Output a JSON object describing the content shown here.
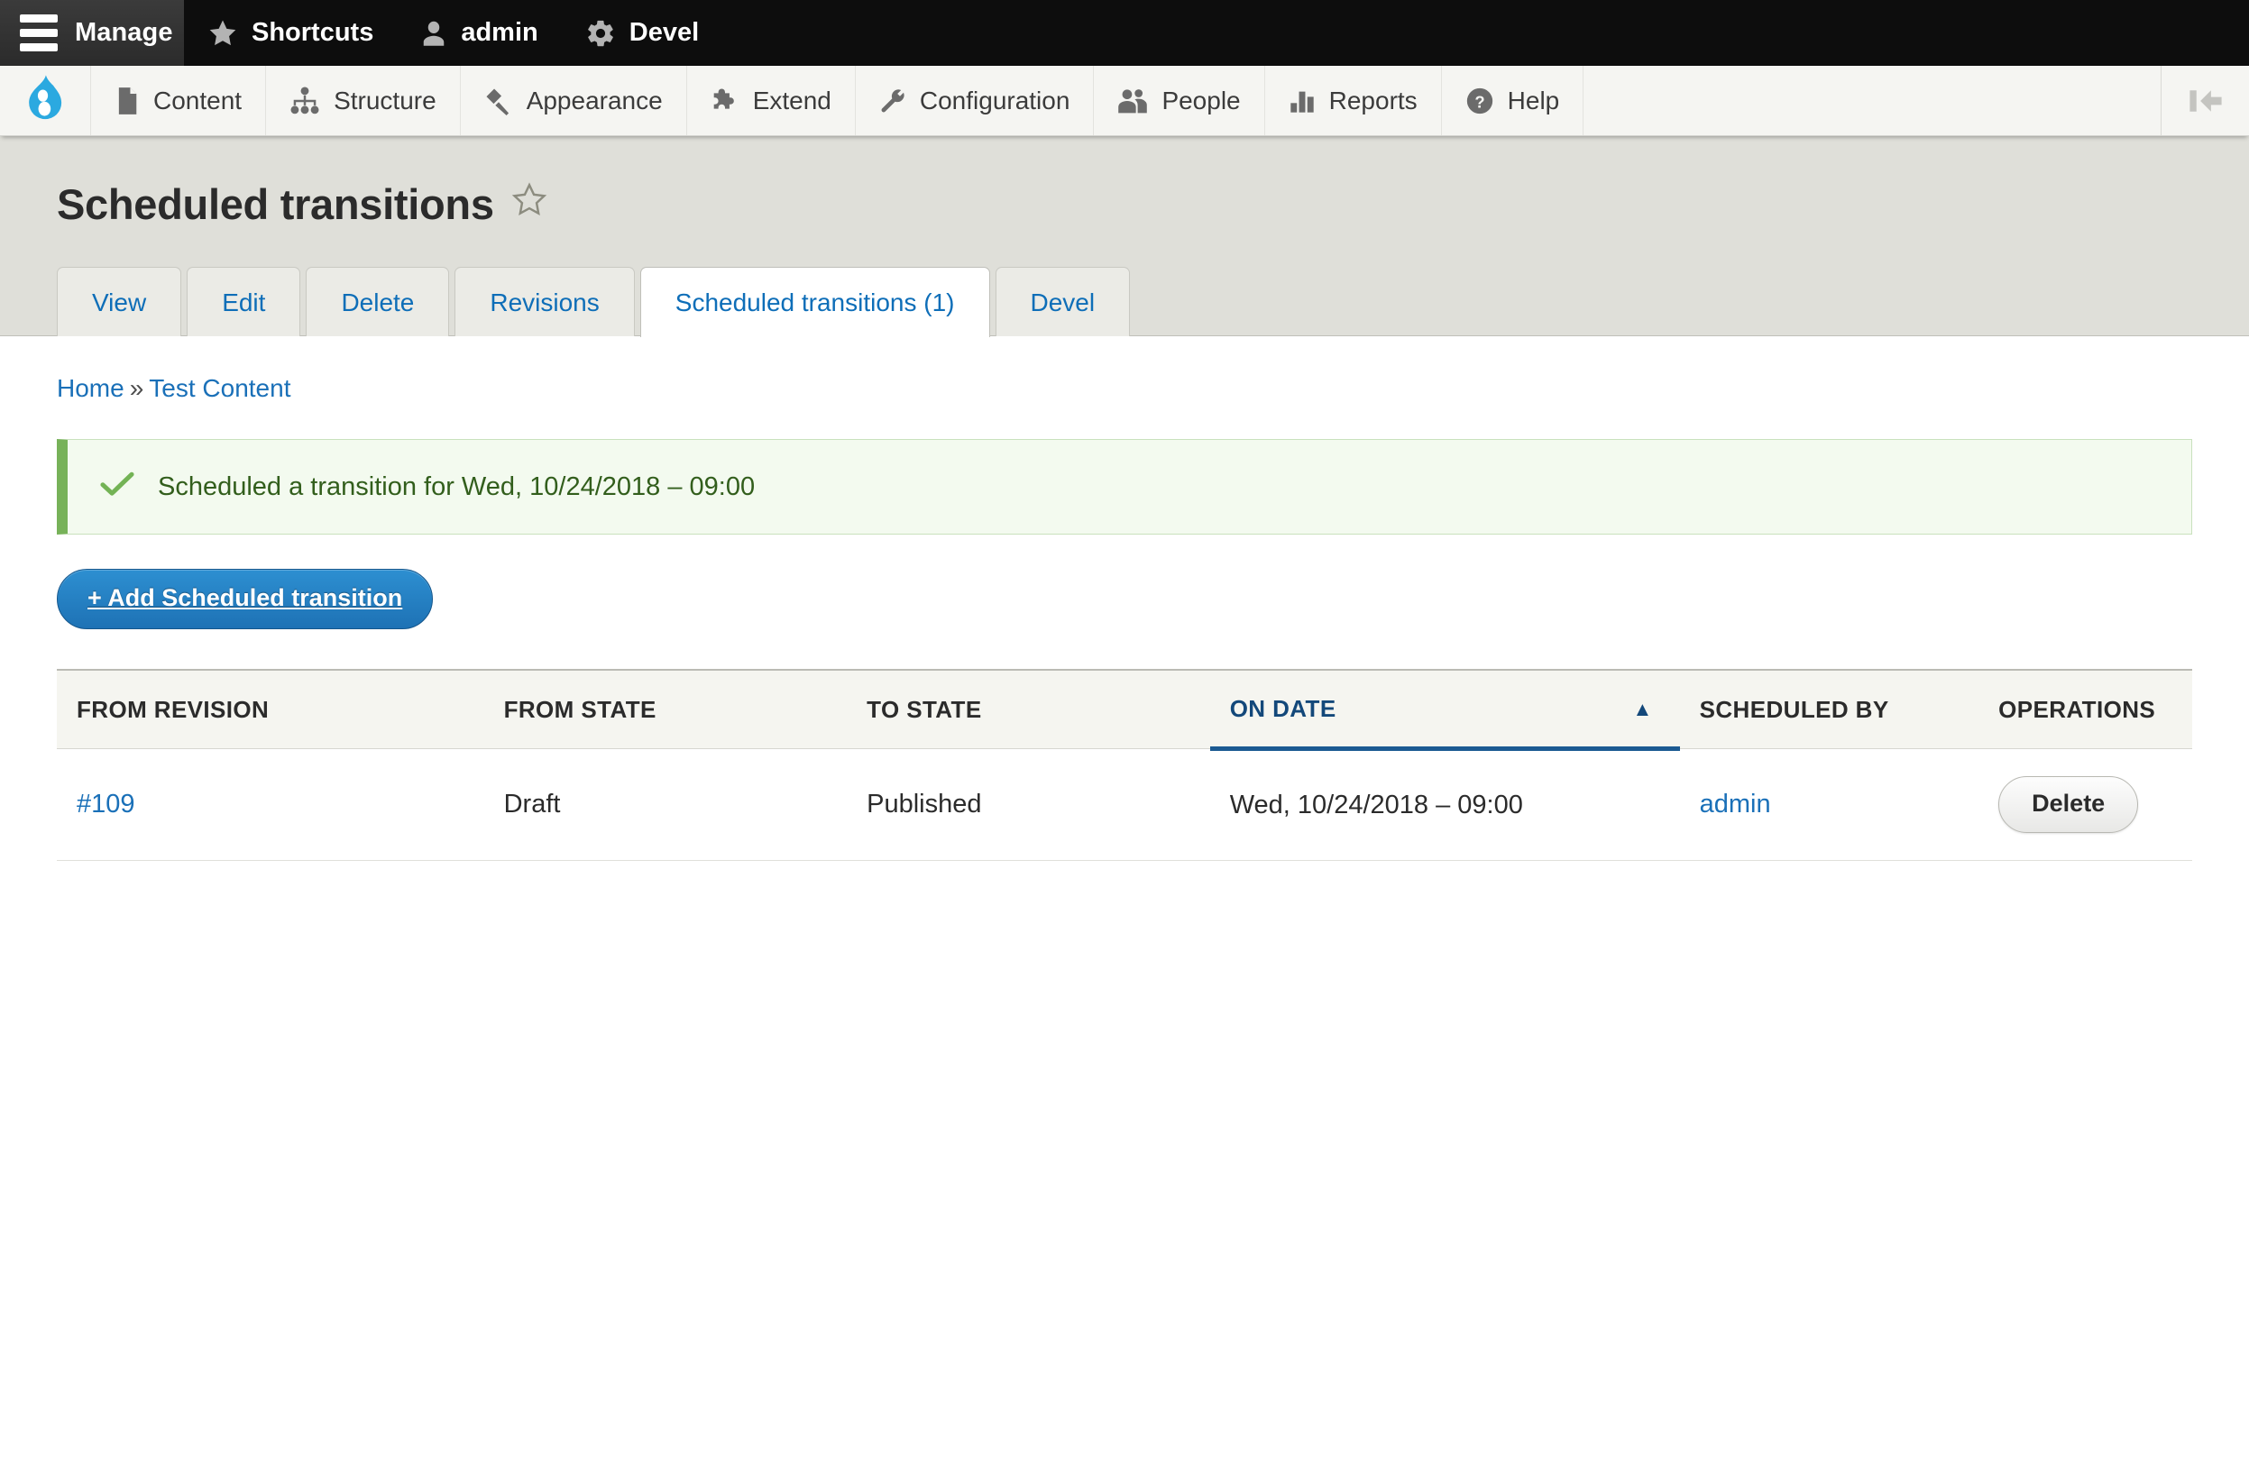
{
  "toolbar": {
    "home_label": "Manage",
    "items": [
      {
        "label": "Shortcuts",
        "icon": "star-icon"
      },
      {
        "label": "admin",
        "icon": "user-icon"
      },
      {
        "label": "Devel",
        "icon": "gear-icon"
      }
    ]
  },
  "menu": {
    "logo": "drupal-logo",
    "items": [
      {
        "label": "Content",
        "icon": "document-icon"
      },
      {
        "label": "Structure",
        "icon": "sitemap-icon"
      },
      {
        "label": "Appearance",
        "icon": "paintbrush-icon"
      },
      {
        "label": "Extend",
        "icon": "puzzle-icon"
      },
      {
        "label": "Configuration",
        "icon": "wrench-icon"
      },
      {
        "label": "People",
        "icon": "people-icon"
      },
      {
        "label": "Reports",
        "icon": "bar-chart-icon"
      },
      {
        "label": "Help",
        "icon": "question-mark-icon"
      }
    ],
    "toggle_icon": "collapse-toolbar-icon"
  },
  "page": {
    "title": "Scheduled transitions",
    "favorite_icon": "star-outline-icon"
  },
  "tabs": [
    {
      "label": "View",
      "active": false
    },
    {
      "label": "Edit",
      "active": false
    },
    {
      "label": "Delete",
      "active": false
    },
    {
      "label": "Revisions",
      "active": false
    },
    {
      "label": "Scheduled transitions (1)",
      "active": true
    },
    {
      "label": "Devel",
      "active": false
    }
  ],
  "breadcrumb": {
    "items": [
      "Home",
      "Test Content"
    ],
    "separator": "»"
  },
  "status_message": {
    "icon": "checkmark-icon",
    "text": "Scheduled a transition for Wed, 10/24/2018 – 09:00"
  },
  "add_button": {
    "label": "+ Add Scheduled transition"
  },
  "table": {
    "columns": [
      {
        "label": "FROM REVISION",
        "sorted": false
      },
      {
        "label": "FROM STATE",
        "sorted": false
      },
      {
        "label": "TO STATE",
        "sorted": false
      },
      {
        "label": "ON DATE",
        "sorted": true,
        "sort_direction": "asc",
        "sort_arrow": "▲"
      },
      {
        "label": "SCHEDULED BY",
        "sorted": false
      },
      {
        "label": "OPERATIONS",
        "sorted": false
      }
    ],
    "rows": [
      {
        "from_revision": "#109",
        "from_state": "Draft",
        "to_state": "Published",
        "on_date": "Wed, 10/24/2018 – 09:00",
        "scheduled_by": "admin",
        "operation_label": "Delete"
      }
    ]
  },
  "colors": {
    "link": "#1a70b8",
    "primary_button": "#1e72b5",
    "status_green": "#77b259",
    "sort_blue": "#1b5a92"
  }
}
